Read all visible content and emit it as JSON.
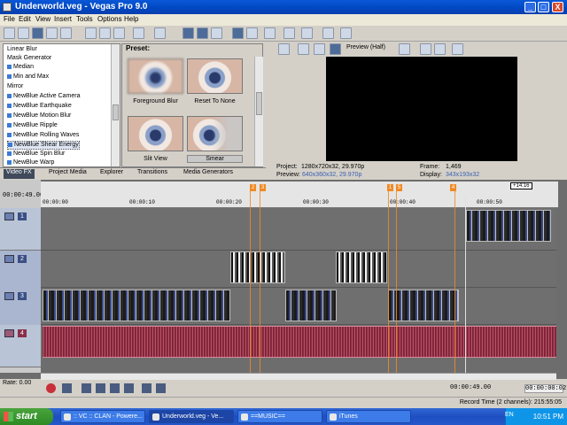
{
  "window": {
    "title": "Underworld.veg - Vegas Pro 9.0",
    "min": "_",
    "max": "□",
    "close": "X"
  },
  "menu": [
    "File",
    "Edit",
    "View",
    "Insert",
    "Tools",
    "Options",
    "Help"
  ],
  "fx_list": {
    "items": [
      "Linear Blur",
      "Mask Generator",
      "Median",
      "Min and Max",
      "Mirror",
      "NewBlue Active Camera",
      "NewBlue Earthquake",
      "NewBlue Motion Blur",
      "NewBlue Ripple",
      "NewBlue Rolling Waves",
      "NewBlue Shear Energy",
      "NewBlue Spin Blur",
      "NewBlue Warp"
    ],
    "selected": "NewBlue Shear Energy"
  },
  "presets": {
    "header": "Preset:",
    "items": [
      "Foreground Blur",
      "Reset To None",
      "Slit View",
      "Smear"
    ],
    "selected": "Smear"
  },
  "tabs": [
    "Video FX",
    "Project Media",
    "Explorer",
    "Transitions",
    "Media Generators"
  ],
  "preview": {
    "quality": "Preview (Half)",
    "project_label": "Project:",
    "project_value": "1280x720x32, 29.970p",
    "preview_label": "Preview:",
    "preview_value": "640x360x32, 29.970p",
    "frame_label": "Frame:",
    "frame_value": "1,469",
    "display_label": "Display:",
    "display_value": "343x193x32"
  },
  "timeline": {
    "timecode": "00:00:49.00",
    "ruler_labels": [
      "00:00:00",
      "00:00:10",
      "00:00:20",
      "00:00:30",
      "00:00:40",
      "00:00:50"
    ],
    "markers": [
      "2",
      "3",
      "1",
      "5",
      "4"
    ],
    "cursor_badge": "+14:16",
    "tracks": [
      "1",
      "2",
      "3",
      "4"
    ]
  },
  "transport": {
    "rate": "Rate: 0.00",
    "position": "00:00:49.00",
    "end": "00:00:00:02",
    "record_time": "Record Time (2 channels): 215:55:05"
  },
  "taskbar": {
    "start": "start",
    "buttons": [
      ":: VC :: CLAN - Powere...",
      "Underworld.veg - Ve...",
      "==MUSIC==",
      "iTunes"
    ],
    "lang": "EN",
    "clock": "10:51 PM"
  }
}
